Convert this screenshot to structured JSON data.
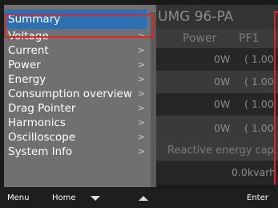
{
  "device_title": "UMG 96-PA",
  "table_header": {
    "col1": "Power",
    "col2": "PF1"
  },
  "table_rows": [
    {
      "power": "0W",
      "pf": "( 1.00"
    },
    {
      "power": "0W",
      "pf": "( 1.00"
    },
    {
      "power": "0W",
      "pf": "( 1.00"
    },
    {
      "power": "0W",
      "pf": "( 1.00"
    }
  ],
  "reactive_section": {
    "label": "Reactive energy cap.",
    "value": "0.0kvarh"
  },
  "menu": {
    "items": [
      {
        "label": "Summary"
      },
      {
        "label": "Voltage"
      },
      {
        "label": "Current"
      },
      {
        "label": "Power"
      },
      {
        "label": "Energy"
      },
      {
        "label": "Consumption overview"
      },
      {
        "label": "Drag Pointer"
      },
      {
        "label": "Harmonics"
      },
      {
        "label": "Oscilloscope"
      },
      {
        "label": "System Info"
      }
    ],
    "chevron": ">"
  },
  "softkeys": {
    "menu": "Menu",
    "home": "Home",
    "down_icon": "triangle-down",
    "up_icon": "triangle-up",
    "enter": "Enter"
  },
  "colors": {
    "highlight_border": "#d9262b",
    "selected_item": "#2d6fb3",
    "menu_panel": "#707070"
  }
}
